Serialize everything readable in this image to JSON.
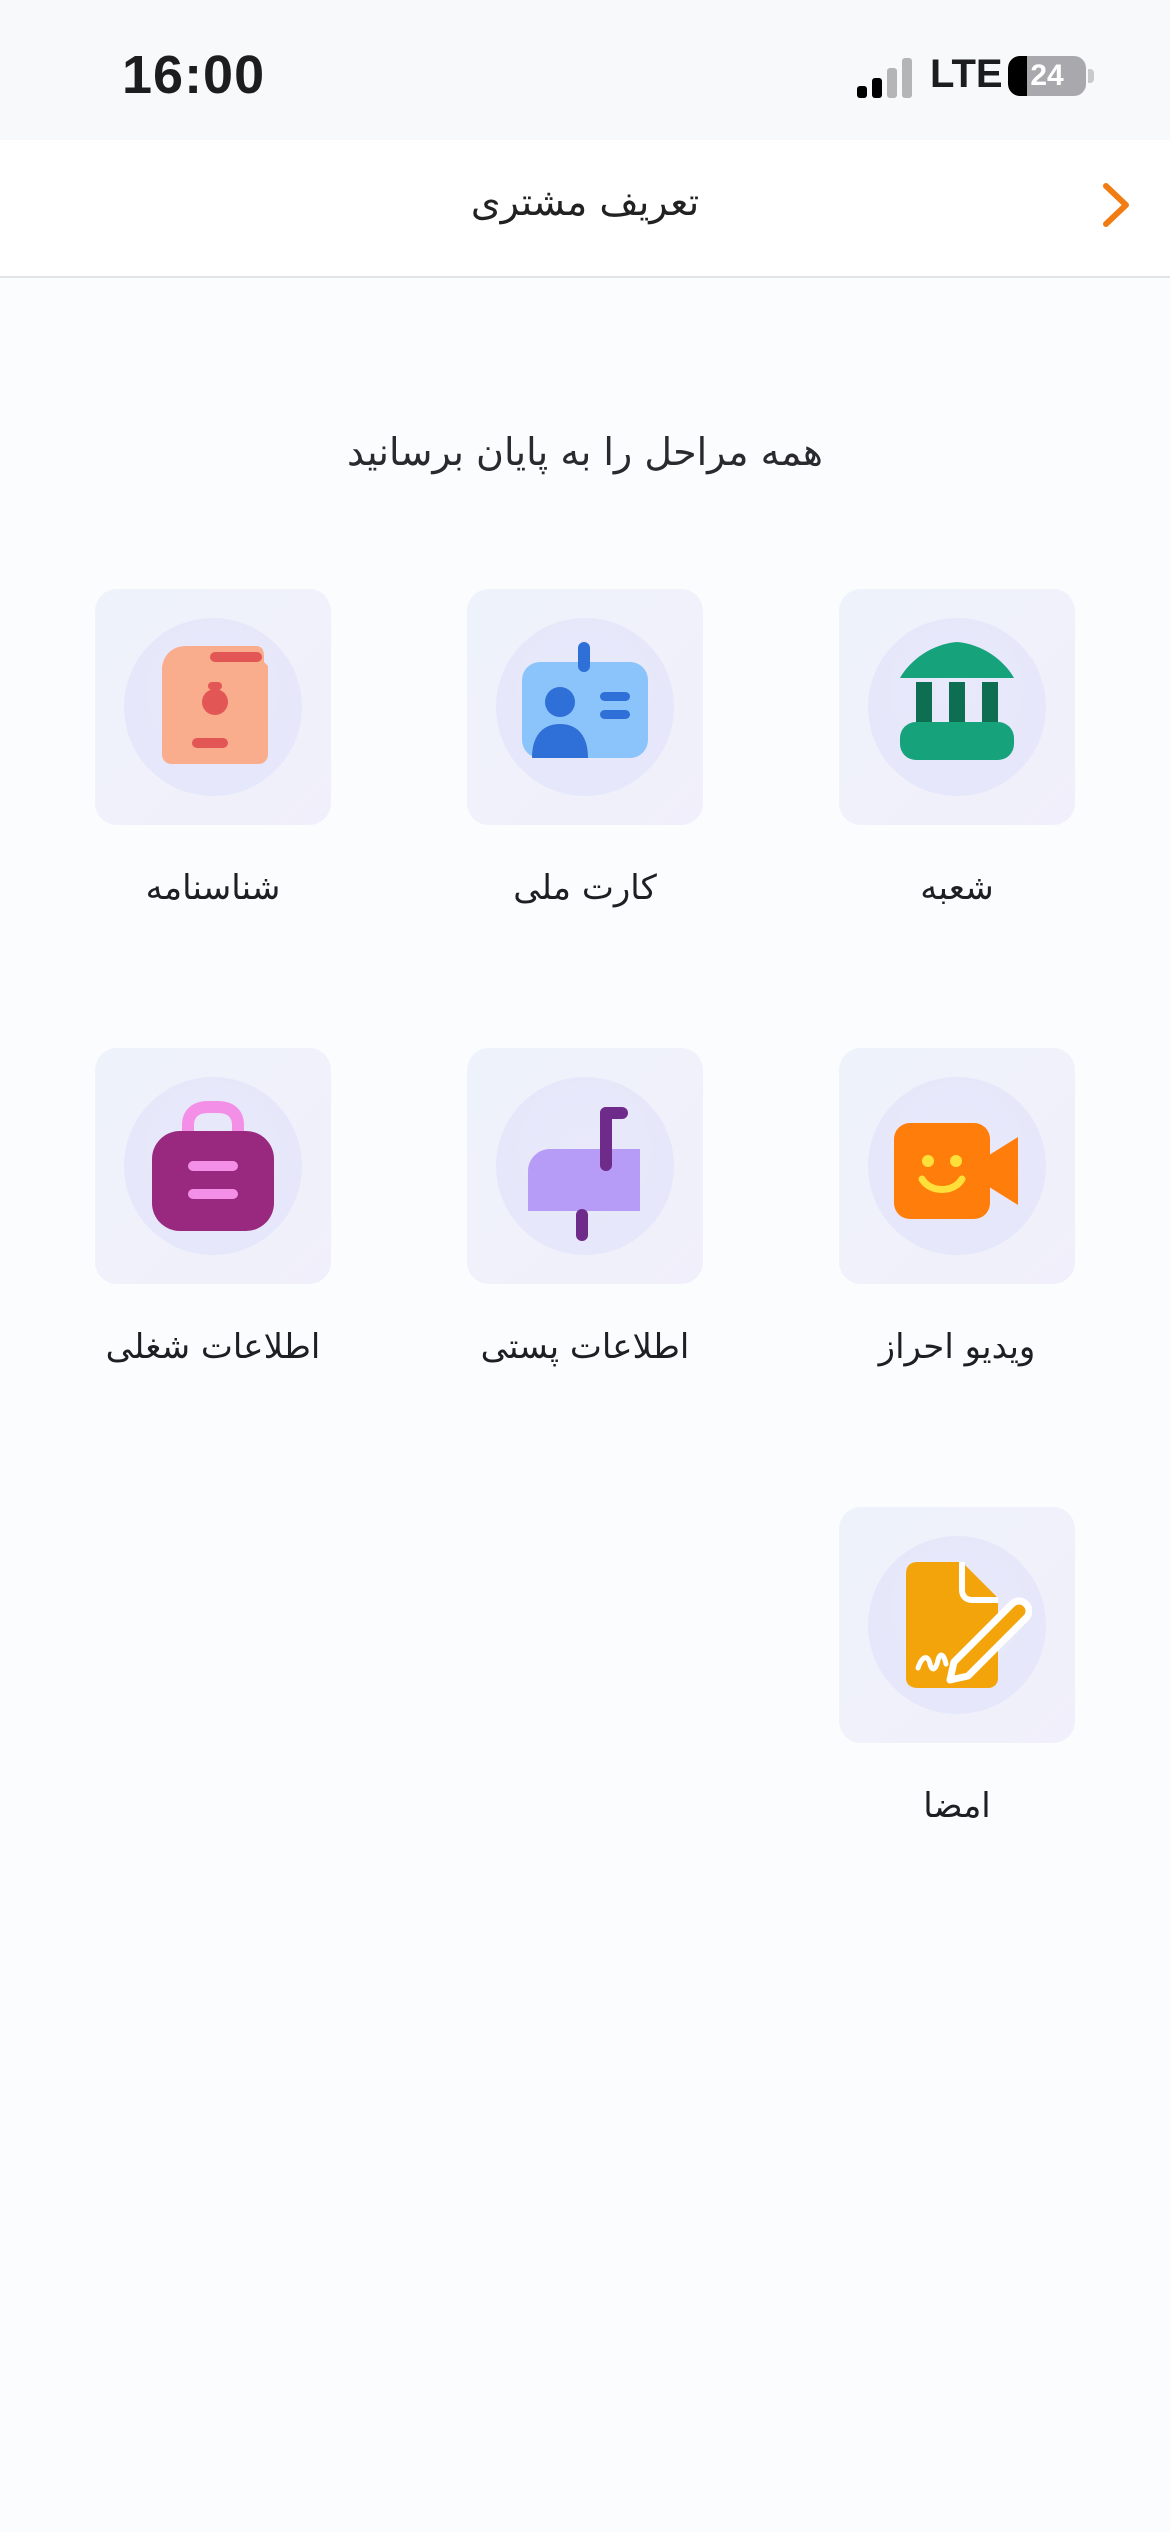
{
  "status": {
    "time": "16:00",
    "network": "LTE",
    "battery": "24",
    "battery_level": 0.24
  },
  "header": {
    "title": "تعریف مشتری",
    "back_icon": "chevron-right-icon"
  },
  "subtitle": "همه مراحل را به پایان برسانید",
  "steps": [
    {
      "label": "شعبه",
      "icon": "bank-icon"
    },
    {
      "label": "کارت ملی",
      "icon": "id-card-icon"
    },
    {
      "label": "شناسنامه",
      "icon": "birth-certificate-icon"
    },
    {
      "label": "ویدیو احراز",
      "icon": "video-camera-icon"
    },
    {
      "label": "اطلاعات پستی",
      "icon": "mailbox-icon"
    },
    {
      "label": "اطلاعات شغلی",
      "icon": "briefcase-icon"
    },
    {
      "label": "امضا",
      "icon": "signature-document-icon"
    }
  ],
  "colors": {
    "accent": "#f07c12",
    "bank": "#16a27b",
    "id_card": "#8bc4fb",
    "birth_cert": "#f9ad8c",
    "video": "#ff7d0a",
    "mailbox": "#b69bf7",
    "briefcase": "#98297f",
    "signature": "#f2a40a"
  }
}
